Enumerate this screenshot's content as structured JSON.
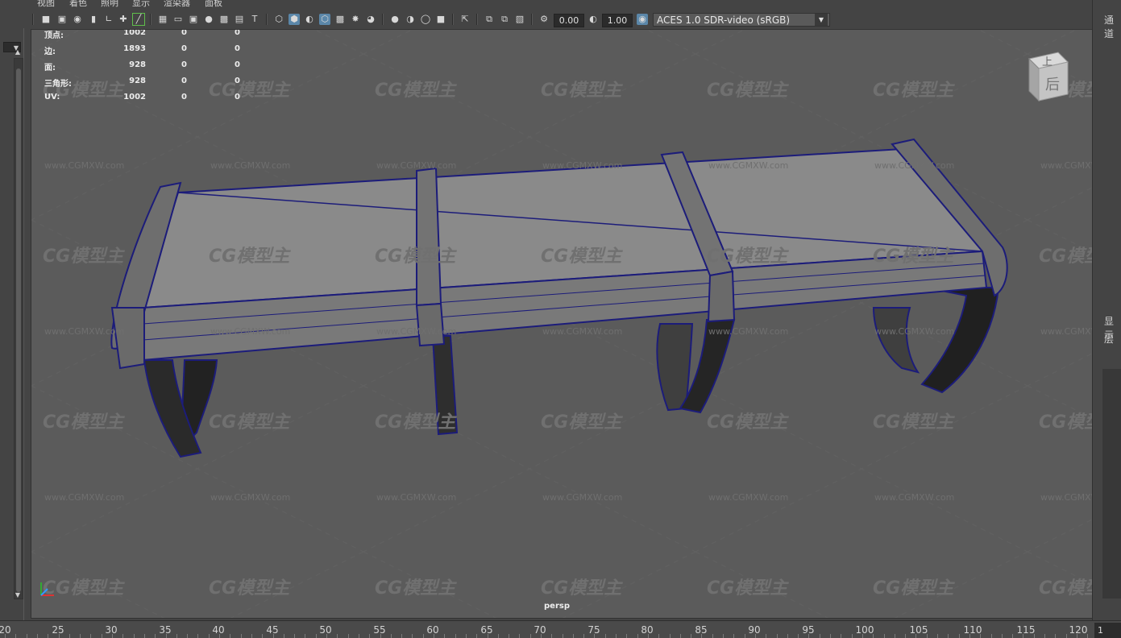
{
  "menu": {
    "items": [
      "视图",
      "着色",
      "照明",
      "显示",
      "渲染器",
      "面板"
    ]
  },
  "toolbar": {
    "exposure_value": "0.00",
    "gamma_value": "1.00",
    "color_space": "ACES 1.0 SDR-video (sRGB)"
  },
  "hud": {
    "rows": [
      {
        "label": "顶点:",
        "v1": "1002",
        "v2": "0",
        "v3": "0"
      },
      {
        "label": "边:",
        "v1": "1893",
        "v2": "0",
        "v3": "0"
      },
      {
        "label": "面:",
        "v1": "928",
        "v2": "0",
        "v3": "0"
      },
      {
        "label": "三角形:",
        "v1": "928",
        "v2": "0",
        "v3": "0"
      },
      {
        "label": "UV:",
        "v1": "1002",
        "v2": "0",
        "v3": "0"
      }
    ]
  },
  "viewport": {
    "camera_label": "persp",
    "viewcube_top": "上",
    "viewcube_back": "后"
  },
  "watermark": {
    "logo": "CG模型主",
    "url": "www.CGMXW.com"
  },
  "right_panel": {
    "tab_top": "通道",
    "tab_display": "显示",
    "tab_layer": "层"
  },
  "timeline": {
    "ticks": [
      "20",
      "25",
      "30",
      "35",
      "40",
      "45",
      "50",
      "55",
      "60",
      "65",
      "70",
      "75",
      "80",
      "85",
      "90",
      "95",
      "100",
      "105",
      "110",
      "115",
      "120"
    ],
    "current_frame": "1"
  },
  "colors": {
    "viewport_bg": "#5b5b5b",
    "wireframe": "#1c1c7a",
    "mesh_fill": "#8a8a8a",
    "accent": "#5b87a9"
  }
}
